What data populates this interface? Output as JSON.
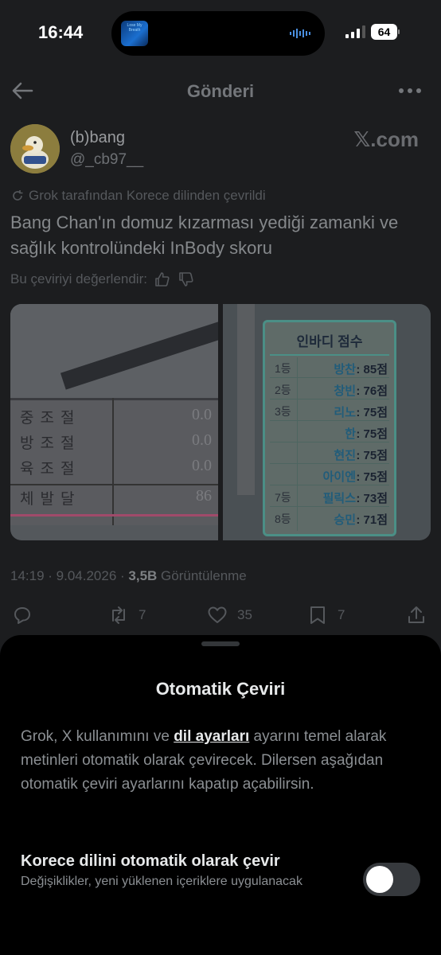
{
  "status_bar": {
    "time": "16:44",
    "now_playing_art_text": "Lose My Breath",
    "battery": "64"
  },
  "header": {
    "title": "Gönderi",
    "back_icon": "arrow-left-icon",
    "more_icon": "more-horizontal-icon"
  },
  "post": {
    "author_name": "(b)bang",
    "author_handle": "@_cb97__",
    "source_mark": "𝕏.com",
    "translated_note": "Grok tarafından Korece dilinden çevrildi",
    "text": "Bang Chan'ın domuz kızarması yediği zamanki ve sağlık kontrolündeki InBody skoru",
    "rate_prompt": "Bu çeviriyi değerlendir:",
    "image_left": {
      "rows": [
        {
          "label": "중조절",
          "value": "0.0"
        },
        {
          "label": "방조절",
          "value": "0.0"
        },
        {
          "label": "육조절",
          "value": "0.0"
        },
        {
          "label": "체발달",
          "value": "86"
        }
      ]
    },
    "image_right": {
      "title": "인바디 점수",
      "rows": [
        {
          "rank": "1등",
          "name": "방찬",
          "score": ": 85점"
        },
        {
          "rank": "2등",
          "name": "창빈",
          "score": ": 76점"
        },
        {
          "rank": "3등",
          "name": "리노",
          "score": ": 75점"
        },
        {
          "rank": "",
          "name": "한",
          "score": ": 75점"
        },
        {
          "rank": "",
          "name": "현진",
          "score": ": 75점"
        },
        {
          "rank": "",
          "name": "아이엔",
          "score": ": 75점"
        },
        {
          "rank": "7등",
          "name": "필릭스",
          "score": ": 73점"
        },
        {
          "rank": "8등",
          "name": "승민",
          "score": ": 71점"
        }
      ]
    },
    "timestamp": "14:19 · 9.04.2026 · ",
    "views_count": "3,5B",
    "views_label": " Görüntülenme",
    "actions": {
      "reply_count": "",
      "repost_count": "7",
      "like_count": "35",
      "bookmark_count": "7"
    }
  },
  "sheet": {
    "title": "Otomatik Çeviri",
    "desc_part1": "Grok, X kullanımını ve ",
    "desc_link": "dil ayarları",
    "desc_part2": " ayarını temel alarak metinleri otomatik olarak çevirecek. Dilersen aşağıdan otomatik çeviri ayarlarını kapatıp açabilirsin.",
    "setting_label": "Korece dilini otomatik olarak çevir",
    "setting_sub": "Değişiklikler, yeni yüklenen içeriklere uygulanacak",
    "toggle_on": false
  },
  "colors": {
    "background_dimmed": "#1c1d1f",
    "sheet": "#000000",
    "toggle_off": "#36393d"
  }
}
